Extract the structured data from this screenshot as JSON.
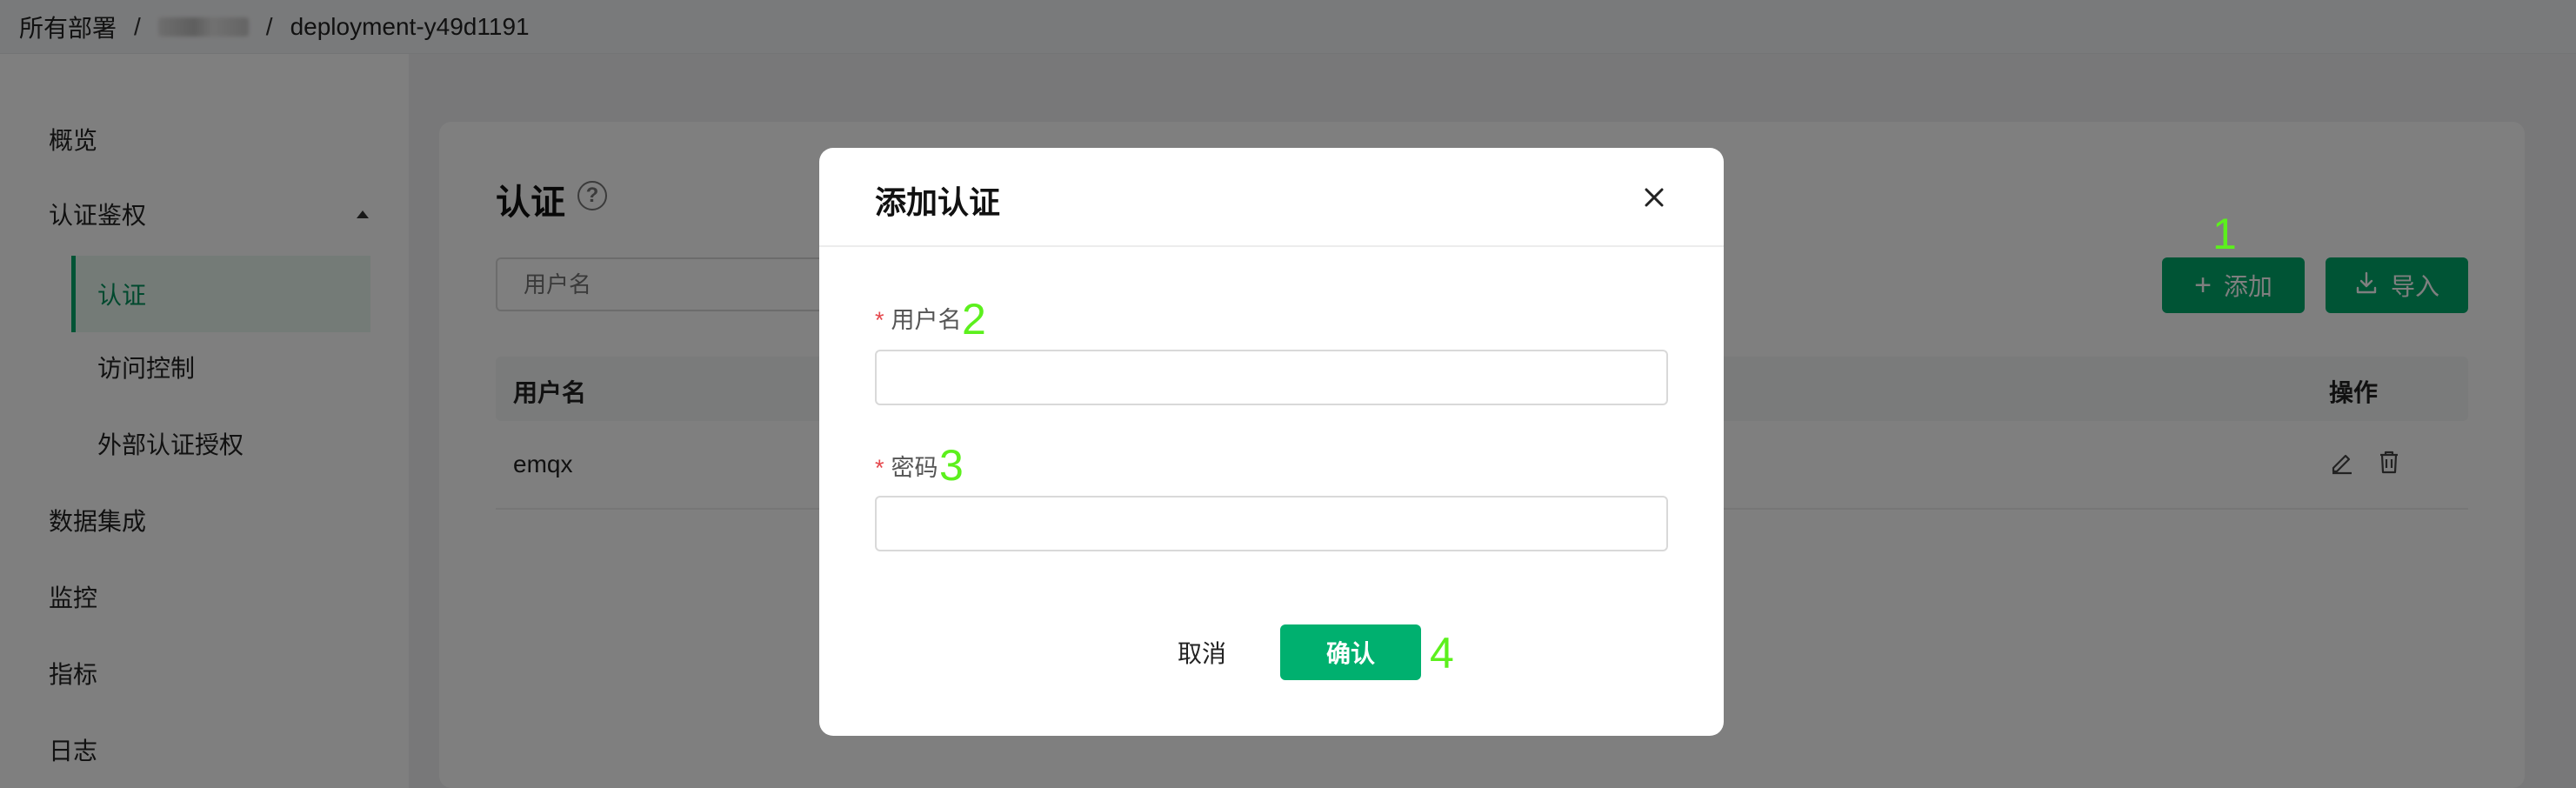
{
  "breadcrumb": {
    "root": "所有部署",
    "separator": "/",
    "current": "deployment-y49d1191"
  },
  "sidebar": {
    "items": [
      {
        "label": "概览"
      },
      {
        "label": "认证鉴权"
      },
      {
        "label": "认证"
      },
      {
        "label": "访问控制"
      },
      {
        "label": "外部认证授权"
      },
      {
        "label": "数据集成"
      },
      {
        "label": "监控"
      },
      {
        "label": "指标"
      },
      {
        "label": "日志"
      }
    ],
    "active": "认证"
  },
  "main": {
    "title": "认证",
    "search_placeholder": "用户名",
    "add_label": "添加",
    "import_label": "导入",
    "table": {
      "columns": [
        "用户名",
        "操作"
      ],
      "rows": [
        {
          "username": "emqx"
        }
      ]
    }
  },
  "dialog": {
    "title": "添加认证",
    "username_label": "用户名",
    "password_label": "密码",
    "username_value": "",
    "password_value": "",
    "cancel_label": "取消",
    "confirm_label": "确认",
    "required_mark": "*"
  },
  "markers": [
    "1",
    "2",
    "3",
    "4"
  ],
  "colors": {
    "accent": "#00a86b",
    "marker": "#5cf01d",
    "required": "#e5484d"
  },
  "icons": {
    "help": "question-circle-icon",
    "add": "plus-icon",
    "import": "download-icon",
    "edit": "edit-icon",
    "delete": "trash-icon",
    "close": "close-icon",
    "collapse": "caret-up-icon"
  }
}
